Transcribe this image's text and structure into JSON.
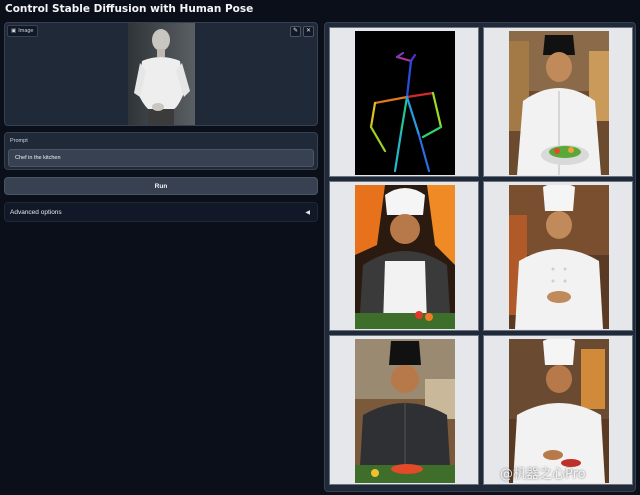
{
  "app": {
    "title": "Control Stable Diffusion with Human Pose"
  },
  "image_input": {
    "label": "Image",
    "edit_icon": "pencil-icon",
    "clear_icon": "close-icon"
  },
  "prompt": {
    "label": "Prompt",
    "value": "Chef in the kitchen"
  },
  "run_button": {
    "label": "Run"
  },
  "advanced": {
    "label": "Advanced options",
    "caret": "◀"
  },
  "gallery": {
    "items": [
      {
        "kind": "pose-skeleton"
      },
      {
        "kind": "generated-chef"
      },
      {
        "kind": "generated-chef"
      },
      {
        "kind": "generated-chef"
      },
      {
        "kind": "generated-chef"
      },
      {
        "kind": "generated-chef"
      }
    ]
  },
  "watermark": {
    "text": "@机器之心Pro"
  }
}
